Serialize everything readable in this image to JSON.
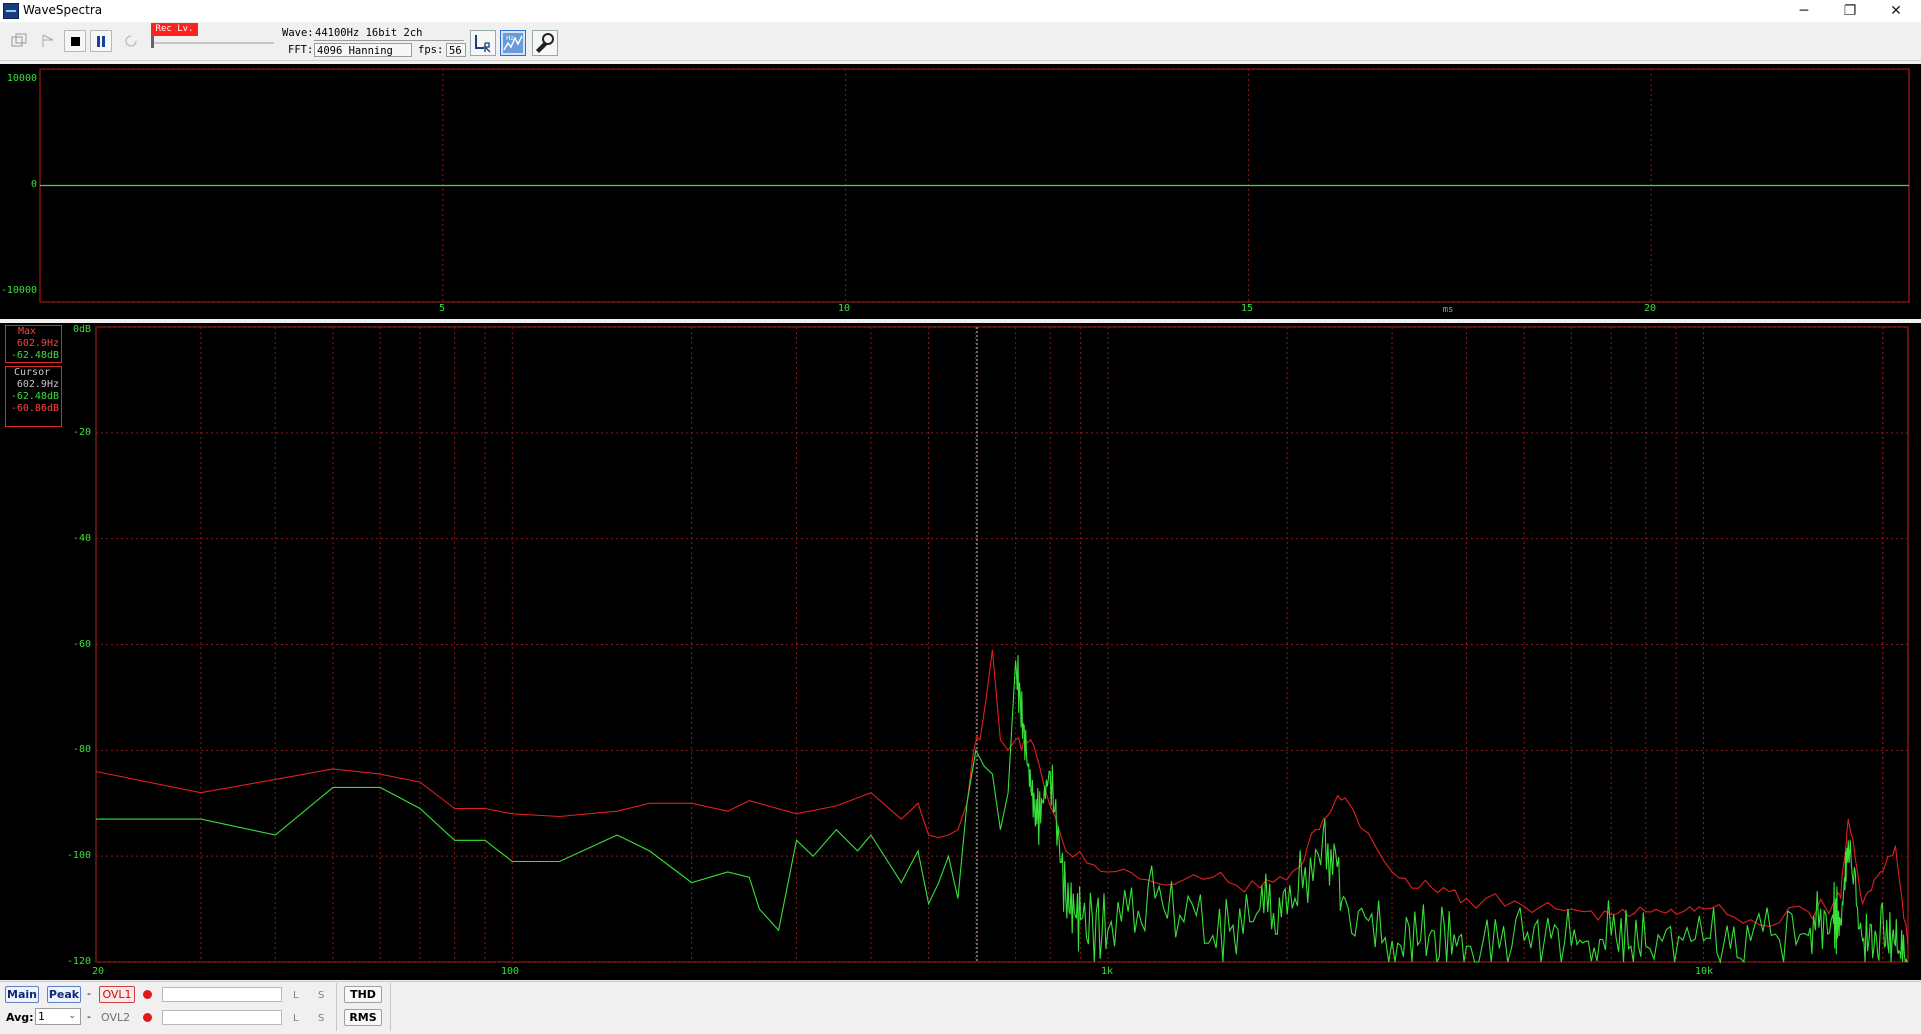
{
  "window": {
    "title": "WaveSpectra",
    "minimize": "─",
    "restore": "❐",
    "close": "✕"
  },
  "toolbar": {
    "rec_level_label": "Rec Lv.",
    "wave_label": "Wave:",
    "wave_value": "44100Hz 16bit 2ch",
    "fft_label": "FFT:",
    "fft_value": "4096 Hanning",
    "fps_label": "fps:",
    "fps_value": "56"
  },
  "icons": {
    "open": "open-folder-icon",
    "play": "play-icon",
    "stop": "stop-icon",
    "pause": "pause-icon",
    "refresh": "refresh-icon",
    "channel": "lr-channel-icon",
    "spectrum": "spectrum-view-icon",
    "settings": "wrench-icon"
  },
  "colors": {
    "waveform": "#38e038",
    "spectrum_green": "#38e038",
    "spectrum_red": "#e02020",
    "grid": "#8a1a1a",
    "cursor": "#cccccc",
    "rec_level": "#ff2020"
  },
  "wave_panel": {
    "y_ticks": [
      "10000",
      "0",
      "-10000"
    ],
    "x_ticks": [
      "5",
      "10",
      "15",
      "20"
    ],
    "x_unit": "ms"
  },
  "spectrum_panel": {
    "y_ticks": [
      "0dB",
      "-20",
      "-40",
      "-60",
      "-80",
      "-100",
      "-120"
    ],
    "x_ticks": [
      "20",
      "100",
      "1k",
      "10k"
    ],
    "readout": {
      "max_label": "Max",
      "max_freq": "602.9Hz",
      "max_db": "-62.48dB",
      "cursor_label": "Cursor",
      "cursor_freq": "602.9Hz",
      "cursor_db_l": "-62.48dB",
      "cursor_db_r": "-60.86dB"
    }
  },
  "chart_data": [
    {
      "type": "line",
      "x_unit": "ms",
      "xlim": [
        0,
        23.2
      ],
      "ylim": [
        -10000,
        10000
      ],
      "x_ticks": [
        5,
        10,
        15,
        20
      ],
      "y_ticks": [
        10000,
        0,
        -10000
      ],
      "grid": true,
      "series": [
        {
          "color": "#38e038",
          "x": [
            0,
            23.2
          ],
          "y": [
            0,
            0
          ]
        }
      ]
    },
    {
      "type": "line",
      "x_scale": "log",
      "x_unit": "Hz",
      "xlim": [
        20,
        22050
      ],
      "ylim": [
        -120,
        0
      ],
      "y_unit": "dB",
      "x_ticks": [
        20,
        100,
        1000,
        10000
      ],
      "y_ticks": [
        0,
        -20,
        -40,
        -60,
        -80,
        -100,
        -120
      ],
      "grid": true,
      "cursor_hz": 602.9,
      "series": [
        {
          "color": "#e02020",
          "x": [
            20,
            30,
            40,
            50,
            60,
            70,
            80,
            90,
            100,
            120,
            150,
            170,
            200,
            230,
            250,
            300,
            350,
            400,
            450,
            480,
            500,
            520,
            540,
            560,
            580,
            595,
            602.9,
            610,
            625,
            640,
            660,
            680,
            700,
            750,
            850,
            1000,
            1200,
            1500,
            1800,
            2100,
            2300,
            2500,
            3000,
            3500,
            4000,
            5000,
            6000,
            7000,
            8000,
            9000,
            10000,
            12000,
            15000,
            16500,
            17000,
            17500,
            18500,
            19800,
            21000,
            22050
          ],
          "y": [
            -84,
            -88,
            -85.5,
            -83.5,
            -84.5,
            -86,
            -91,
            -91,
            -92,
            -92.5,
            -91.5,
            -90,
            -90,
            -91.5,
            -89.5,
            -92,
            -90.5,
            -88,
            -93,
            -90,
            -96,
            -96.5,
            -96,
            -95,
            -90,
            -80,
            -77.5,
            -78,
            -70,
            -61,
            -78,
            -80,
            -78,
            -79,
            -99,
            -103,
            -105,
            -104,
            -106,
            -102,
            -93,
            -89,
            -103,
            -106,
            -108,
            -109.5,
            -110,
            -111,
            -110.5,
            -111,
            -110,
            -112,
            -110.5,
            -109,
            -108,
            -93,
            -109,
            -103,
            -98,
            -117
          ]
        },
        {
          "color": "#38e038",
          "x": [
            20,
            30,
            40,
            50,
            60,
            70,
            80,
            90,
            100,
            120,
            150,
            170,
            200,
            230,
            250,
            260,
            280,
            300,
            320,
            350,
            380,
            400,
            450,
            480,
            500,
            520,
            540,
            560,
            580,
            600,
            620,
            640,
            660,
            680,
            700,
            730,
            760,
            800,
            850,
            900,
            1000,
            1200,
            1500,
            1800,
            2000,
            2300,
            2500,
            3000,
            3500,
            4000,
            5000,
            6000,
            7000,
            8000,
            10000,
            12000,
            15000,
            16500,
            17000,
            17500,
            18500,
            19800,
            21000,
            22050
          ],
          "y": [
            -93,
            -93,
            -96,
            -87,
            -87,
            -91,
            -97,
            -97,
            -101,
            -101,
            -96,
            -99,
            -105,
            -103,
            -104,
            -110,
            -114,
            -97,
            -100,
            -95,
            -99,
            -96,
            -105,
            -99,
            -109,
            -105,
            -100,
            -108,
            -90,
            -80,
            -83,
            -84.5,
            -95,
            -88,
            -63,
            -81,
            -94,
            -84,
            -108,
            -112,
            -114,
            -108,
            -115,
            -110,
            -111,
            -95,
            -108,
            -116,
            -114,
            -117,
            -116,
            -117,
            -115,
            -117,
            -116,
            -116,
            -115,
            -111,
            -113,
            -97,
            -116,
            -114,
            -117,
            -120
          ]
        }
      ]
    }
  ],
  "bottom": {
    "main": "Main",
    "peak": "Peak",
    "dash1": "-",
    "ovl1": "OVL1",
    "dash2": "-",
    "ovl2": "OVL2",
    "avg_label": "Avg:",
    "avg_value": "1",
    "l": "L",
    "s": "S",
    "thd": "THD",
    "rms": "RMS"
  }
}
